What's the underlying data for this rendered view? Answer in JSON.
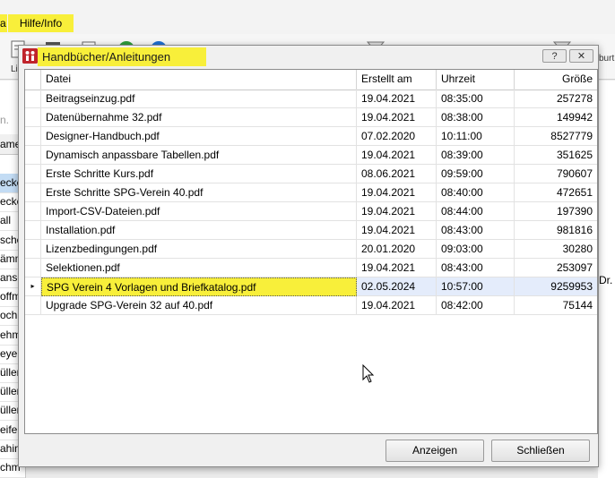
{
  "background": {
    "menu_left": "a",
    "menu_hilfe": "Hilfe/Info",
    "toolbar_label_list": "Lis",
    "toolbar_label_right": "burt",
    "search_hint": "n. um",
    "column_head": "ame",
    "rows": [
      "ecke",
      "ecke",
      "all",
      "sche",
      "ämm",
      "anse",
      "offm",
      "och",
      "ehm",
      "eyer",
      "üller",
      "üller",
      "üller",
      "eifer",
      "ahin",
      "chm"
    ],
    "right_cell": "Dr.",
    "highlight_color": "#f8ef3a"
  },
  "dialog": {
    "title": "Handbücher/Anleitungen",
    "help_button": "?",
    "close_button": "✕",
    "columns": {
      "datei": "Datei",
      "erstellt": "Erstellt am",
      "uhrzeit": "Uhrzeit",
      "groesse": "Größe"
    },
    "selected_index": 10,
    "rows": [
      {
        "datei": "Beitragseinzug.pdf",
        "erstellt": "19.04.2021",
        "uhrzeit": "08:35:00",
        "groesse": "257278"
      },
      {
        "datei": "Datenübernahme 32.pdf",
        "erstellt": "19.04.2021",
        "uhrzeit": "08:38:00",
        "groesse": "149942"
      },
      {
        "datei": "Designer-Handbuch.pdf",
        "erstellt": "07.02.2020",
        "uhrzeit": "10:11:00",
        "groesse": "8527779"
      },
      {
        "datei": "Dynamisch anpassbare Tabellen.pdf",
        "erstellt": "19.04.2021",
        "uhrzeit": "08:39:00",
        "groesse": "351625"
      },
      {
        "datei": "Erste Schritte Kurs.pdf",
        "erstellt": "08.06.2021",
        "uhrzeit": "09:59:00",
        "groesse": "790607"
      },
      {
        "datei": "Erste Schritte SPG-Verein 40.pdf",
        "erstellt": "19.04.2021",
        "uhrzeit": "08:40:00",
        "groesse": "472651"
      },
      {
        "datei": "Import-CSV-Dateien.pdf",
        "erstellt": "19.04.2021",
        "uhrzeit": "08:44:00",
        "groesse": "197390"
      },
      {
        "datei": "Installation.pdf",
        "erstellt": "19.04.2021",
        "uhrzeit": "08:43:00",
        "groesse": "981816"
      },
      {
        "datei": "Lizenzbedingungen.pdf",
        "erstellt": "20.01.2020",
        "uhrzeit": "09:03:00",
        "groesse": "30280"
      },
      {
        "datei": "Selektionen.pdf",
        "erstellt": "19.04.2021",
        "uhrzeit": "08:43:00",
        "groesse": "253097"
      },
      {
        "datei": "SPG Verein 4 Vorlagen und Briefkatalog.pdf",
        "erstellt": "02.05.2024",
        "uhrzeit": "10:57:00",
        "groesse": "9259953"
      },
      {
        "datei": "Upgrade SPG-Verein 32 auf 40.pdf",
        "erstellt": "19.04.2021",
        "uhrzeit": "08:42:00",
        "groesse": "75144"
      }
    ],
    "buttons": {
      "anzeigen": "Anzeigen",
      "schliessen": "Schließen"
    }
  }
}
